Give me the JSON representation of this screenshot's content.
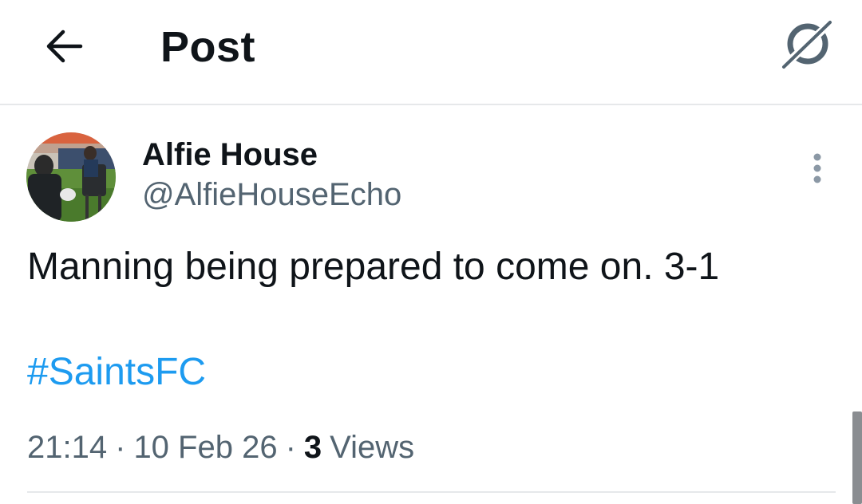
{
  "header": {
    "title": "Post",
    "back_icon": "arrow-left-icon",
    "grok_icon": "grok-icon"
  },
  "post": {
    "author_name": "Alfie House",
    "author_handle": "@AlfieHouseEcho",
    "text": "Manning being prepared to come on. 3-1",
    "hashtag": "#SaintsFC",
    "time": "21:14",
    "date": "10 Feb 26",
    "separator": "·",
    "views_count": "3",
    "views_label": "Views",
    "more_icon": "more-vertical-icon"
  },
  "colors": {
    "text_primary": "#0f1419",
    "text_secondary": "#536471",
    "link": "#1d9bf0",
    "divider": "#e6e8ea"
  }
}
